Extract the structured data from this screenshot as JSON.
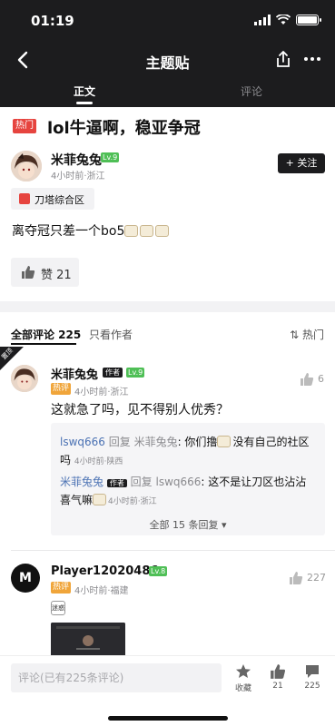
{
  "status_bar": {
    "time": "01:19"
  },
  "nav": {
    "title": "主题贴",
    "tabs": [
      "正文",
      "评论"
    ]
  },
  "post": {
    "hot_tag": "热门",
    "title": "lol牛逼啊，稳亚争冠",
    "author": {
      "name": "米菲兔兔",
      "level": "Lv.9",
      "meta": "4小时前·浙江"
    },
    "follow_label": "+ 关注",
    "forum": "刀塔综合区",
    "body": "离夺冠只差一个bo5",
    "likes_label": "赞 21"
  },
  "comments_header": {
    "all_label": "全部评论 225",
    "author_only_label": "只看作者",
    "sort_label": "热门",
    "ribbon": "置顶"
  },
  "comments": [
    {
      "name": "米菲兔兔",
      "author_badge": "作者",
      "level": "Lv.9",
      "hot_badge": "热评",
      "meta": "4小时前·浙江",
      "likes": "6",
      "text": "这就急了吗，见不得别人优秀？",
      "replies": {
        "r1_user": "lswq666",
        "r1_verb": " 回复 ",
        "r1_target": "米菲兔兔",
        "r1_text_a": ": 你们撸",
        "r1_text_b": "没有自己的社区",
        "r1_text_c": "吗",
        "r1_meta": "4小时前·陕西",
        "r2_user": "米菲兔兔",
        "r2_badge": "作者",
        "r2_verb": " 回复 ",
        "r2_target": "lswq666",
        "r2_text_a": ": 这不是让刀区也沾沾",
        "r2_text_b": "喜气嘛",
        "r2_meta": "4小时前·浙江",
        "more": "全部 15 条回复 ▾"
      }
    },
    {
      "name": "Player12020486",
      "level": "Lv.8",
      "hot_badge": "热评",
      "meta": "4小时前·福建",
      "likes": "227",
      "avatar_letter": "M",
      "emoji_text": "迷惑"
    }
  ],
  "bottom_bar": {
    "input_placeholder": "评论(已有225条评论)",
    "actions": [
      {
        "icon": "star-icon",
        "label": "收藏"
      },
      {
        "icon": "thumb-up-icon",
        "label": "21"
      },
      {
        "icon": "comment-icon",
        "label": "225"
      }
    ]
  },
  "colors": {
    "header": "#1c1c1e",
    "hot": "#e6443f",
    "level": "#4fbf56",
    "hot_comment": "#f0a53a",
    "link": "#4a71b3"
  }
}
